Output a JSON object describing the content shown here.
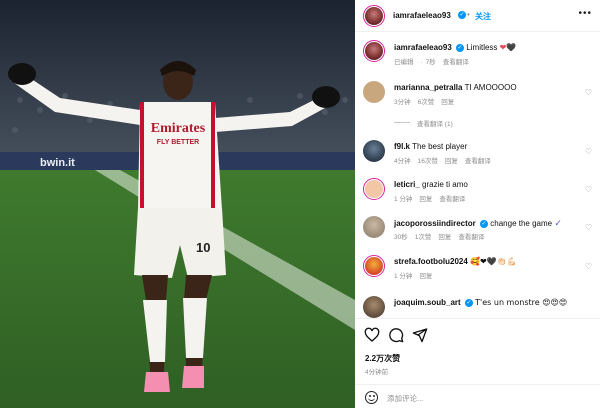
{
  "post": {
    "author": "iamrafaeleao93",
    "follow_label": "关注",
    "more_icon": "more-horizontal-icon"
  },
  "caption": {
    "username": "iamrafaeleao93",
    "text": "Limitless",
    "emojis": "❤ 🖤",
    "meta_edited": "已编辑",
    "meta_time": "7秒",
    "meta_translate": "查看翻译"
  },
  "comments": [
    {
      "username": "marianna_petralla",
      "verified": false,
      "text": "TI AMOOOOO",
      "time": "3分钟",
      "likes": "6次赞",
      "reply": "回复",
      "translate": "",
      "avatar_color": "#c8a77e"
    },
    {
      "username": "",
      "verified": false,
      "text": "",
      "time": "",
      "likes": "",
      "reply": "",
      "translate": "",
      "view_translation": "查看翻译 (1)",
      "avatar_color": ""
    },
    {
      "username": "f9l.k",
      "verified": false,
      "text": "The best player",
      "time": "4分钟",
      "likes": "16次赞",
      "reply": "回复",
      "translate": "查看翻译",
      "avatar_color": "#2c3b4d"
    },
    {
      "username": "leticri_",
      "verified": false,
      "text": "grazie ti amo",
      "time": "1 分钟",
      "likes": "",
      "reply": "回复",
      "translate": "查看翻译",
      "avatar_color": "#f3c6a6"
    },
    {
      "username": "jacoporossiindirector",
      "verified": true,
      "text": "change the game",
      "time": "30秒",
      "likes": "1次赞",
      "reply": "回复",
      "translate": "查看翻译",
      "avatar_color": "#9a8b78"
    },
    {
      "username": "strefa.footbolu2024",
      "verified": false,
      "text": "🥰❤🖤👏🏻💪🏻",
      "time": "1 分钟",
      "likes": "",
      "reply": "回复",
      "translate": "",
      "avatar_color": "#d6452b"
    },
    {
      "username": "joaquim.soub_art",
      "verified": true,
      "text": "T'es un monstre 😍😍😍",
      "time": "",
      "likes": "",
      "reply": "",
      "translate": "",
      "avatar_color": "#5e4b3c"
    }
  ],
  "actions": {
    "like_icon": "heart-icon",
    "comment_icon": "comment-icon",
    "share_icon": "share-icon",
    "likes_count": "2.2万次赞",
    "posted_time": "4分钟前",
    "add_comment_placeholder": "添加评论..."
  },
  "photo": {
    "sponsor": "Emirates",
    "sponsor_sub": "FLY BETTER",
    "shirt_number": "10",
    "board_text": "bwin.it"
  },
  "colors": {
    "accent": "#0095f6",
    "muted": "#8e8e8e",
    "heart_red": "#ed4956"
  }
}
